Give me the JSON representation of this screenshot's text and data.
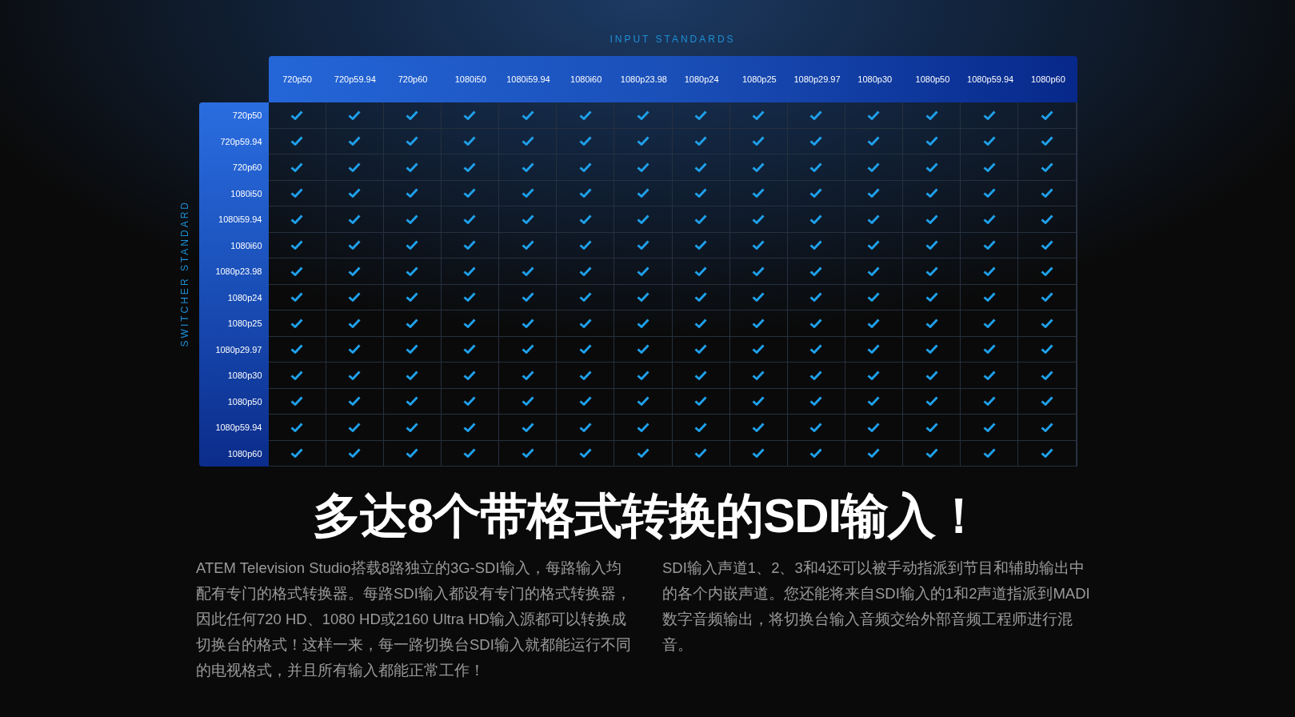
{
  "input_axis_label": "INPUT STANDARDS",
  "switcher_axis_label": "SWITCHER STANDARD",
  "columns": [
    "720p50",
    "720p59.94",
    "720p60",
    "1080i50",
    "1080i59.94",
    "1080i60",
    "1080p23.98",
    "1080p24",
    "1080p25",
    "1080p29.97",
    "1080p30",
    "1080p50",
    "1080p59.94",
    "1080p60"
  ],
  "rows": [
    {
      "label": "720p50",
      "supported": [
        true,
        true,
        true,
        true,
        true,
        true,
        true,
        true,
        true,
        true,
        true,
        true,
        true,
        true
      ]
    },
    {
      "label": "720p59.94",
      "supported": [
        true,
        true,
        true,
        true,
        true,
        true,
        true,
        true,
        true,
        true,
        true,
        true,
        true,
        true
      ]
    },
    {
      "label": "720p60",
      "supported": [
        true,
        true,
        true,
        true,
        true,
        true,
        true,
        true,
        true,
        true,
        true,
        true,
        true,
        true
      ]
    },
    {
      "label": "1080i50",
      "supported": [
        true,
        true,
        true,
        true,
        true,
        true,
        true,
        true,
        true,
        true,
        true,
        true,
        true,
        true
      ]
    },
    {
      "label": "1080i59.94",
      "supported": [
        true,
        true,
        true,
        true,
        true,
        true,
        true,
        true,
        true,
        true,
        true,
        true,
        true,
        true
      ]
    },
    {
      "label": "1080i60",
      "supported": [
        true,
        true,
        true,
        true,
        true,
        true,
        true,
        true,
        true,
        true,
        true,
        true,
        true,
        true
      ]
    },
    {
      "label": "1080p23.98",
      "supported": [
        true,
        true,
        true,
        true,
        true,
        true,
        true,
        true,
        true,
        true,
        true,
        true,
        true,
        true
      ]
    },
    {
      "label": "1080p24",
      "supported": [
        true,
        true,
        true,
        true,
        true,
        true,
        true,
        true,
        true,
        true,
        true,
        true,
        true,
        true
      ]
    },
    {
      "label": "1080p25",
      "supported": [
        true,
        true,
        true,
        true,
        true,
        true,
        true,
        true,
        true,
        true,
        true,
        true,
        true,
        true
      ]
    },
    {
      "label": "1080p29.97",
      "supported": [
        true,
        true,
        true,
        true,
        true,
        true,
        true,
        true,
        true,
        true,
        true,
        true,
        true,
        true
      ]
    },
    {
      "label": "1080p30",
      "supported": [
        true,
        true,
        true,
        true,
        true,
        true,
        true,
        true,
        true,
        true,
        true,
        true,
        true,
        true
      ]
    },
    {
      "label": "1080p50",
      "supported": [
        true,
        true,
        true,
        true,
        true,
        true,
        true,
        true,
        true,
        true,
        true,
        true,
        true,
        true
      ]
    },
    {
      "label": "1080p59.94",
      "supported": [
        true,
        true,
        true,
        true,
        true,
        true,
        true,
        true,
        true,
        true,
        true,
        true,
        true,
        true
      ]
    },
    {
      "label": "1080p60",
      "supported": [
        true,
        true,
        true,
        true,
        true,
        true,
        true,
        true,
        true,
        true,
        true,
        true,
        true,
        true
      ]
    }
  ],
  "headline": "多达8个带格式转换的SDI输入！",
  "paragraphs": [
    "ATEM Television Studio搭载8路独立的3G-SDI输入，每路输入均配有专门的格式转换器。每路SDI输入都设有专门的格式转换器，因此任何720 HD、1080 HD或2160 Ultra HD输入源都可以转换成切换台的格式！这样一来，每一路切换台SDI输入就都能运行不同的电视格式，并且所有输入都能正常工作！",
    "SDI输入声道1、2、3和4还可以被手动指派到节目和辅助输出中的各个内嵌声道。您还能将来自SDI输入的1和2声道指派到MADI数字音频输出，将切换台输入音频交给外部音频工程师进行混音。"
  ]
}
